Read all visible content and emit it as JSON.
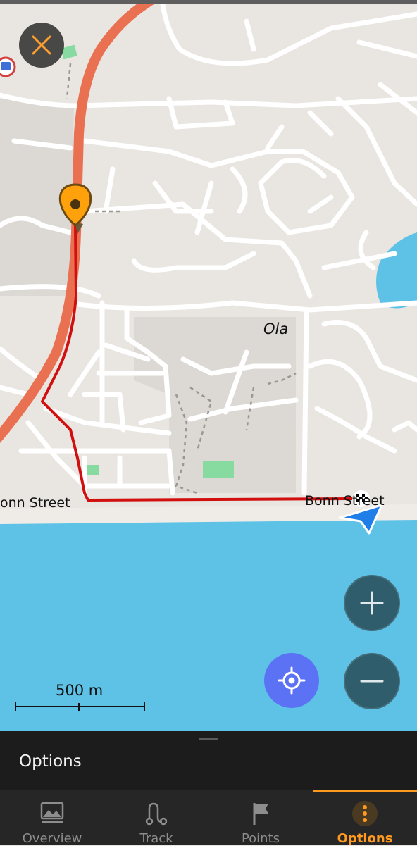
{
  "map": {
    "place_label": "Ola",
    "street_left": "onn Street",
    "street_right": "Bonn Street",
    "scale_label": "500 m",
    "colors": {
      "land": "#e9e5e1",
      "water": "#5ec2e6",
      "road": "#ffffff",
      "highway": "#ea7052",
      "route": "#d10f0f",
      "park": "#88dba0",
      "pin": "#ffa10a"
    }
  },
  "controls": {
    "close_icon": "close-icon",
    "zoom_in_icon": "plus-icon",
    "zoom_out_icon": "minus-icon",
    "locate_icon": "crosshair-icon"
  },
  "sheet": {
    "title": "Options"
  },
  "tabs": [
    {
      "label": "Overview",
      "icon": "overview-icon",
      "active": false
    },
    {
      "label": "Track",
      "icon": "track-icon",
      "active": false
    },
    {
      "label": "Points",
      "icon": "flag-icon",
      "active": false
    },
    {
      "label": "Options",
      "icon": "more-vertical-icon",
      "active": true
    }
  ]
}
